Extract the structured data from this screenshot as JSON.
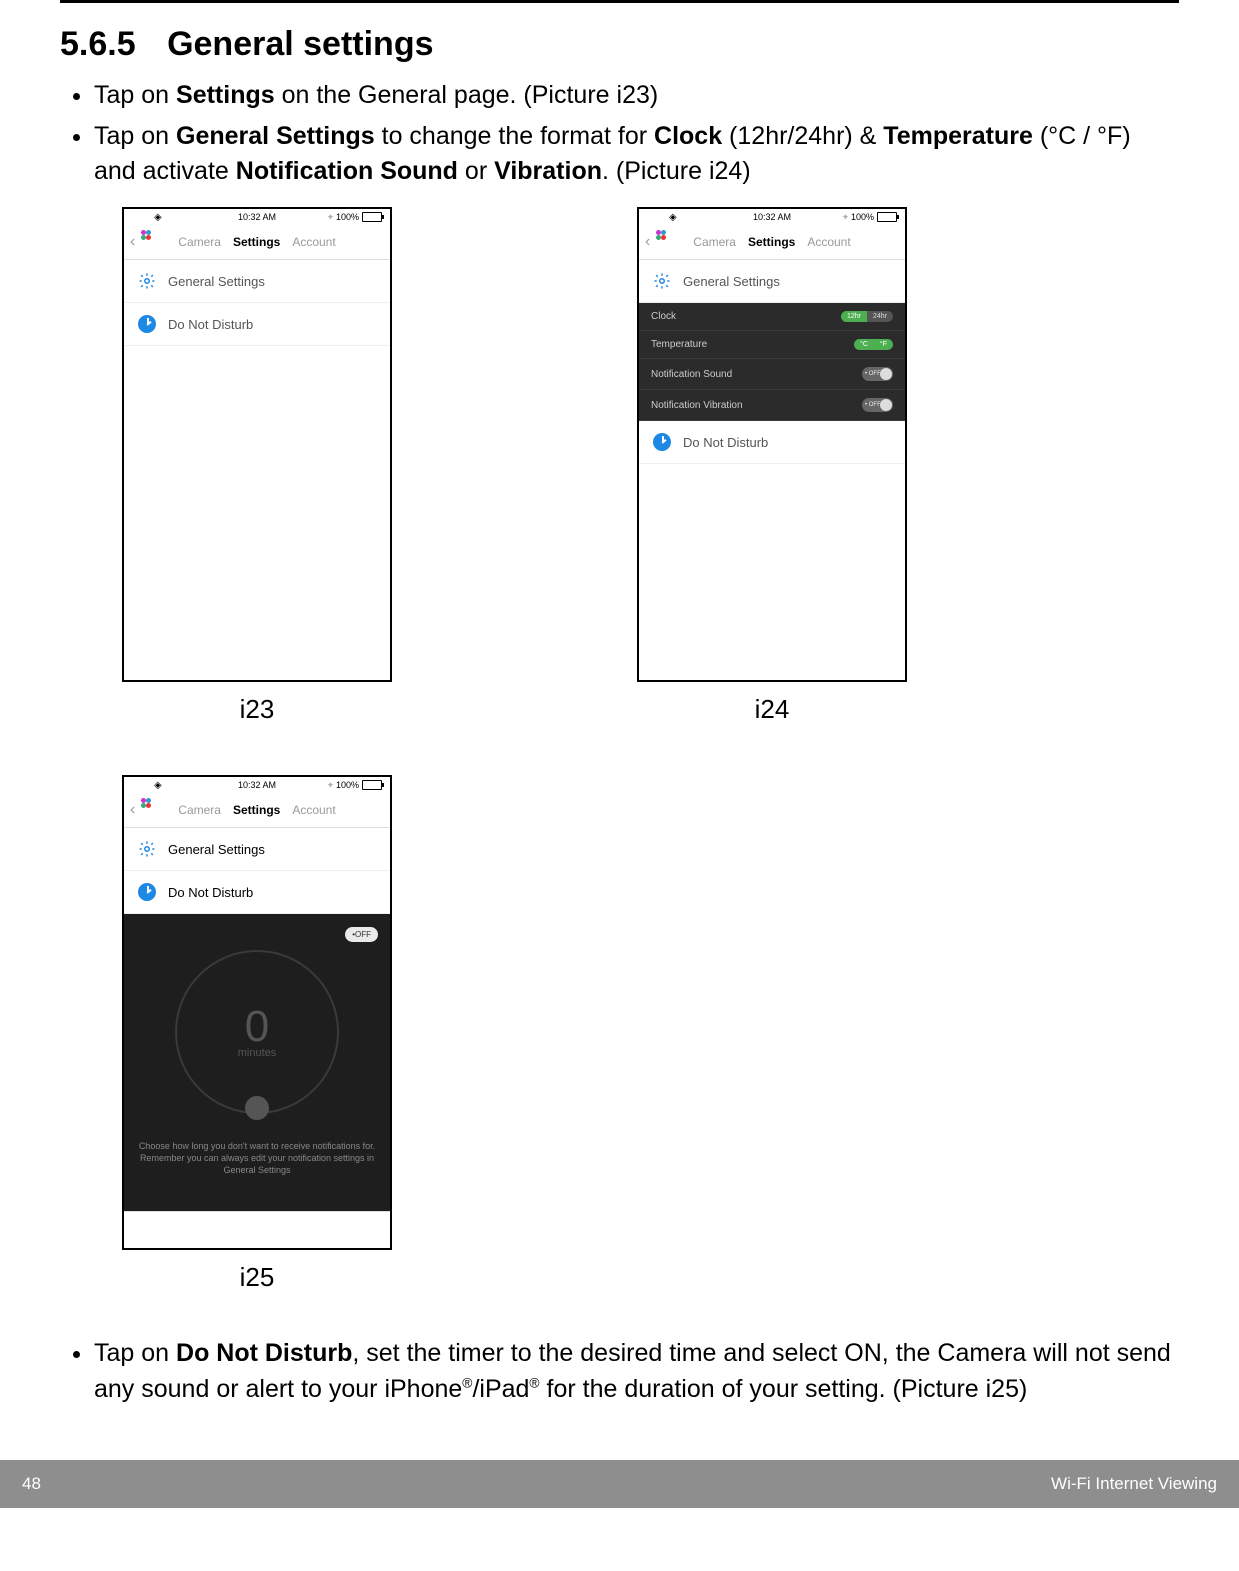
{
  "section": {
    "number": "5.6.5",
    "title": "General settings"
  },
  "bullets_top": {
    "b1_pre": "Tap on ",
    "b1_bold": "Settings",
    "b1_post": " on the General page. (Picture i23)",
    "b2_pre": "Tap on ",
    "b2_bold1": "General Settings",
    "b2_mid1": " to change the format for ",
    "b2_bold2": "Clock",
    "b2_mid2": " (12hr/24hr) & ",
    "b2_bold3": "Temperature",
    "b2_mid3": " (°C / °F) and activate ",
    "b2_bold4": "Notification Sound",
    "b2_mid4": " or ",
    "b2_bold5": "Vibration",
    "b2_post": ". (Picture i24)"
  },
  "captions": {
    "i23": "i23",
    "i24": "i24",
    "i25": "i25"
  },
  "statusbar": {
    "time": "10:32 AM",
    "battery": "100%"
  },
  "nav": {
    "camera": "Camera",
    "settings": "Settings",
    "account": "Account"
  },
  "rows": {
    "general": "General Settings",
    "dnd": "Do Not Disturb"
  },
  "i24": {
    "clock_label": "Clock",
    "clock_opt1": "12hr",
    "clock_opt2": "24hr",
    "temp_label": "Temperature",
    "temp_opt1": "°C",
    "temp_opt2": "°F",
    "sound_label": "Notification Sound",
    "vib_label": "Notification Vibration",
    "off": "• OFF"
  },
  "i25": {
    "off_pill": "•OFF",
    "dial_num": "0",
    "dial_unit": "minutes",
    "help": "Choose how long you don't want to receive notifications for. Remember you can always edit your notification settings in General Settings"
  },
  "bullets_bottom": {
    "pre": "Tap on ",
    "bold": "Do Not Disturb",
    "post1": ", set the timer to the desired time and select ON, the Camera will not send any sound or alert to your iPhone",
    "reg1": "®",
    "post2": "/iPad",
    "reg2": "®",
    "post3": " for the duration of your setting. (Picture i25)"
  },
  "footer": {
    "page": "48",
    "title": "Wi-Fi Internet Viewing"
  }
}
